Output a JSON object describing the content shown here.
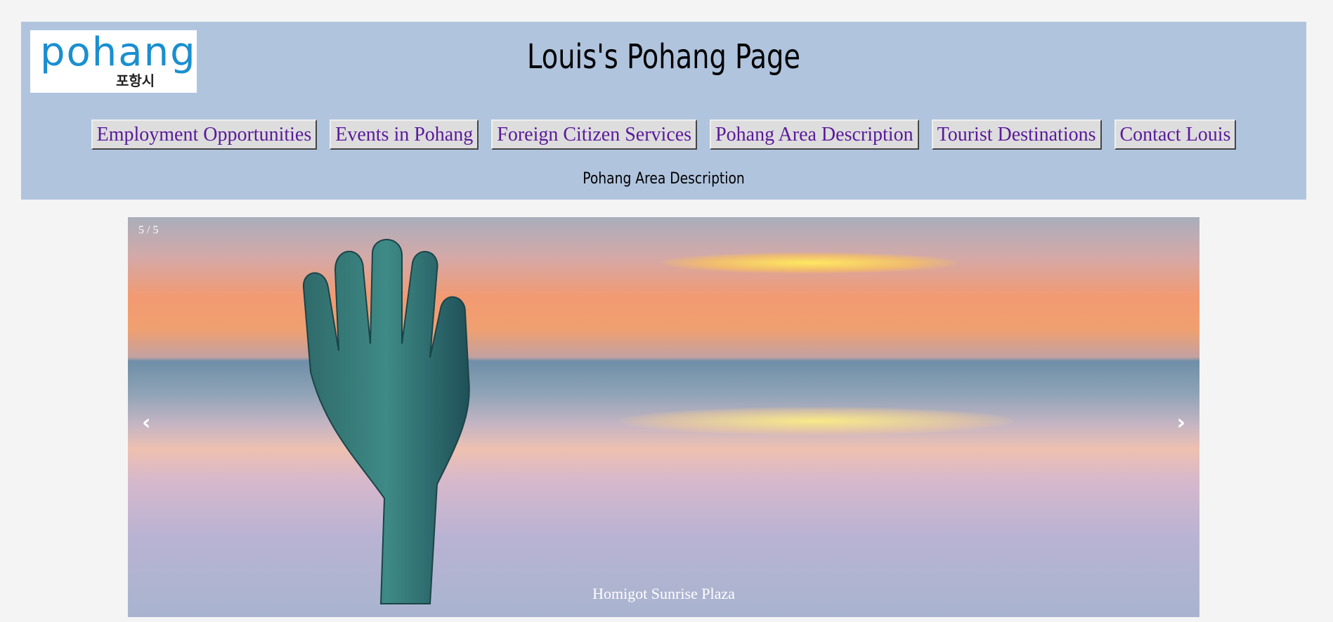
{
  "header": {
    "logo": {
      "word": "pohang",
      "korean": "포항시"
    },
    "title": "Louis's Pohang Page",
    "subtitle": "Pohang Area Description"
  },
  "nav": {
    "items": [
      {
        "label": "Employment Opportunities"
      },
      {
        "label": "Events in Pohang"
      },
      {
        "label": "Foreign Citizen Services"
      },
      {
        "label": "Pohang Area Description"
      },
      {
        "label": "Tourist Destinations"
      },
      {
        "label": "Contact Louis"
      }
    ]
  },
  "slideshow": {
    "counter": "5 / 5",
    "caption": "Homigot Sunrise Plaza",
    "prev_icon": "‹",
    "next_icon": "›"
  },
  "colors": {
    "header_bg": "#b0c4de",
    "nav_text": "#5a1a9a",
    "page_bg": "#f4f4f4"
  }
}
